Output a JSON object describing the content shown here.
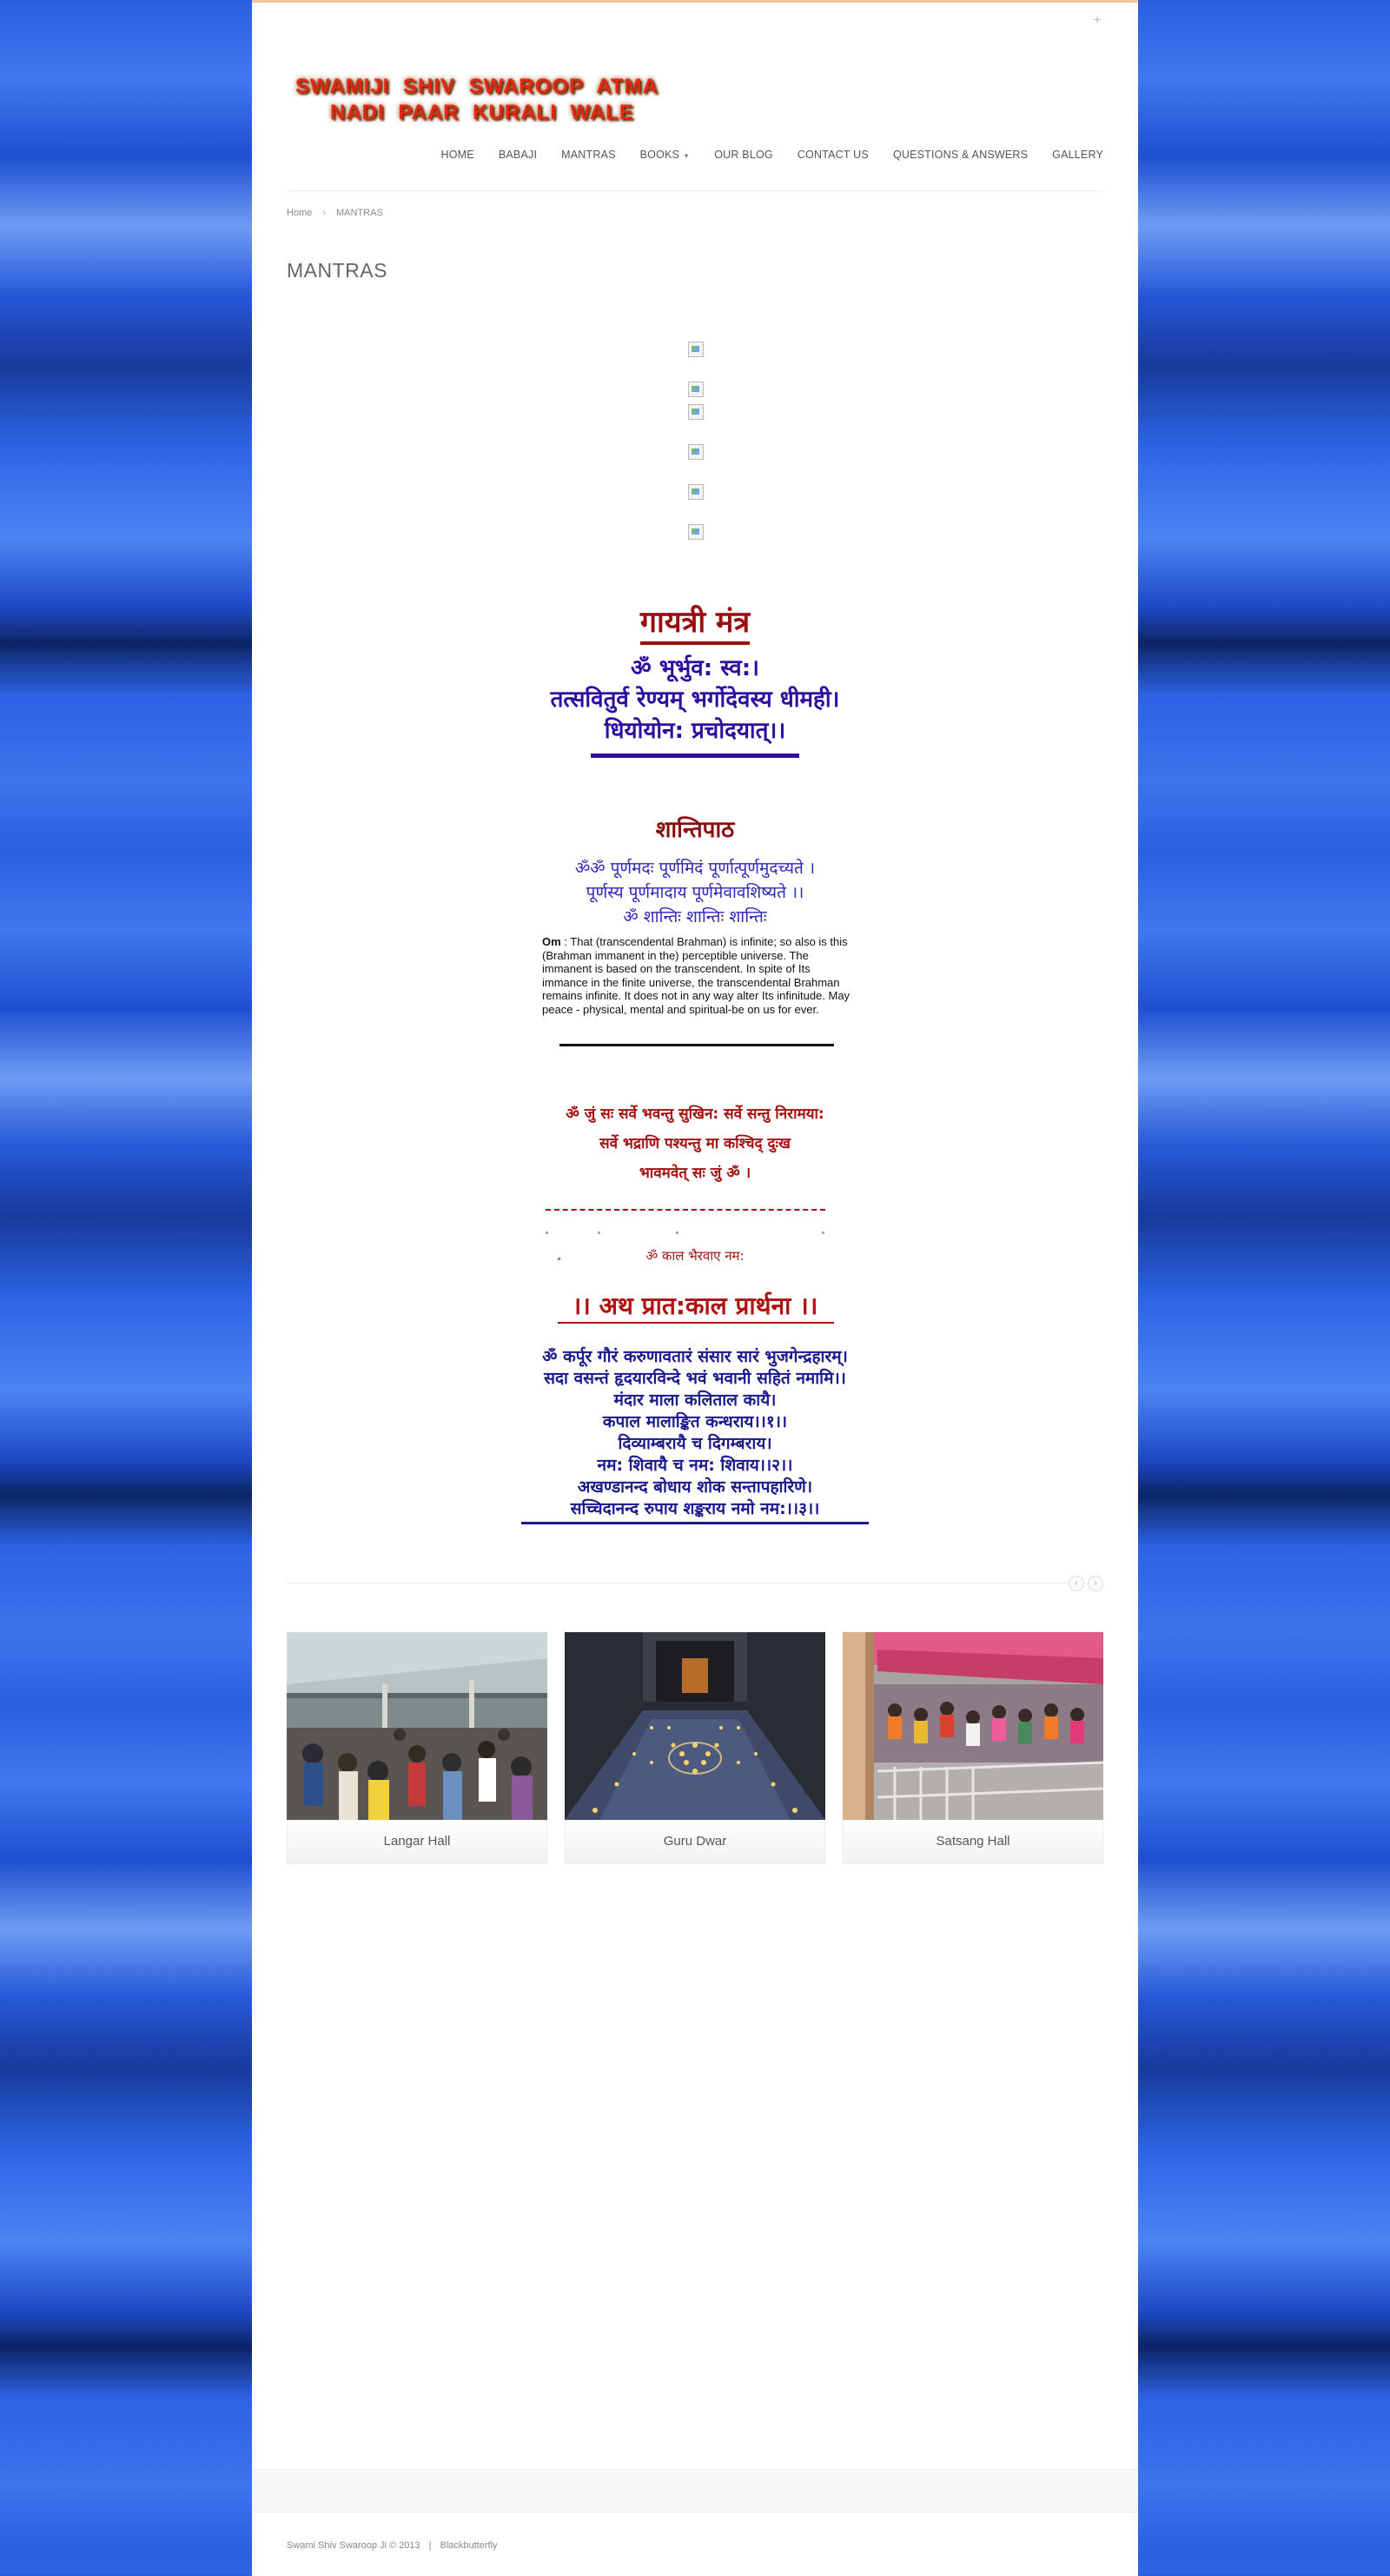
{
  "header": {
    "logo_line1": "SWAMIJI  SHIV  SWAROOP  ATMA",
    "logo_line2": "NADI  PAAR  KURALI  WALE",
    "corner_icon": "plus-icon"
  },
  "nav": {
    "items": [
      {
        "label": "HOME"
      },
      {
        "label": "BABAJI"
      },
      {
        "label": "MANTRAS"
      },
      {
        "label": "BOOKS"
      },
      {
        "label": "OUR BLOG"
      },
      {
        "label": "CONTACT US"
      },
      {
        "label": "QUESTIONS & ANSWERS"
      },
      {
        "label": "GALLERY"
      }
    ]
  },
  "breadcrumb": {
    "home": "Home",
    "separator": "›",
    "current": "MANTRAS"
  },
  "page": {
    "title": "MANTRAS"
  },
  "gayatri": {
    "title": "गायत्री मंत्र",
    "lines": [
      "ॐ भूर्भुव: स्व:।",
      "तत्सवितुर्व रेण्यम् भर्गोदेवस्य धीमही।",
      "धियोयोन: प्रचोदयात्।।"
    ]
  },
  "shanti": {
    "title": "शान्तिपाठ",
    "lines": [
      "ॐॐ पूर्णमदः पूर्णमिदं पूर्णात्पूर्णमुदच्यते ।",
      "पूर्णस्य पूर्णमादाय पूर्णमेवावशिष्यते ।।",
      "ॐ शान्तिः शान्तिः शान्तिः"
    ],
    "english_lead": "Om",
    "english": " : That (transcendental Brahman) is infinite; so also is this (Brahman immanent in the) perceptible universe. The immanent is based on the transcendent. In spite of Its immance in the finite universe, the transcendental Brahman remains infinite. It does not in any way alter Its infinitude. May peace - physical, mental and spiritual-be on us for ever."
  },
  "sarve": {
    "lines": [
      "ॐ जुं सः सर्वे भवन्तु सुखिन: सर्वे सन्तु निरामया:",
      "सर्वे भद्राणि पश्यन्तु मा कश्चिद् दुःख",
      "भावमवेत् सः जुं ॐ ।"
    ]
  },
  "kaal": {
    "line": "ॐ काल भैरवाए नम:"
  },
  "prarthana": {
    "title": "।। अथ प्रात:काल प्रार्थना ।।",
    "lines": [
      "ॐ कर्पूर गौरं करुणावतारं संसार सारं भुजगेन्द्रहारम्।",
      "सदा वसन्तं हृदयारविन्दे भवं भवानी सहितं नमामि।।",
      "मंदार माला कलिताल कायै।",
      "कपाल मालाङ्कित कन्धराय।।१।।",
      "दिव्याम्बरायै च दिगम्बराय।",
      "नम: शिवायै च नम: शिवाय।।२।।",
      "अखण्डानन्द बोधाय शोक सन्तापहारिणे।",
      "सच्चिदानन्द रुपाय शङ्कराय नमो नम:।।३।।"
    ]
  },
  "carousel": {
    "prev_icon": "chevron-left-icon",
    "next_icon": "chevron-right-icon",
    "prev_glyph": "‹",
    "next_glyph": "›",
    "cards": [
      {
        "caption": "Langar Hall"
      },
      {
        "caption": "Guru Dwar"
      },
      {
        "caption": "Satsang Hall"
      }
    ]
  },
  "footer": {
    "copyright": "Swami Shiv Swaroop Ji © 2013",
    "separator": "|",
    "credit": "Blackbutterfly"
  }
}
